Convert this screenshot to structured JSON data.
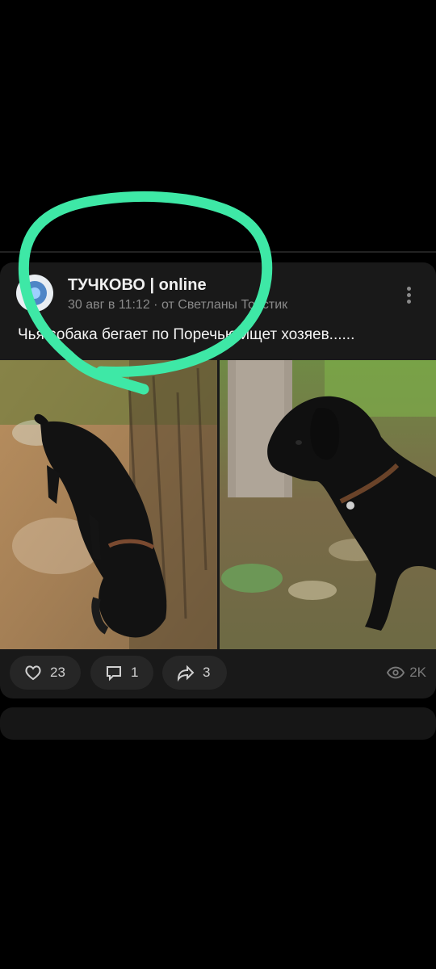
{
  "post": {
    "group_name": "ТУЧКОВО | online",
    "meta": "30 авг в 11:12 · от Светланы Толстик",
    "text": "Чья собака бегает по Поречью ищет хозяев......"
  },
  "actions": {
    "likes": "23",
    "comments": "1",
    "shares": "3",
    "views": "2K"
  },
  "colors": {
    "background": "#000000",
    "card": "#191919",
    "highlight_circle": "#3ee8a6"
  },
  "icons": {
    "like": "heart-icon",
    "comment": "comment-icon",
    "share": "share-icon",
    "views": "eye-icon",
    "menu": "more-vertical-icon"
  }
}
